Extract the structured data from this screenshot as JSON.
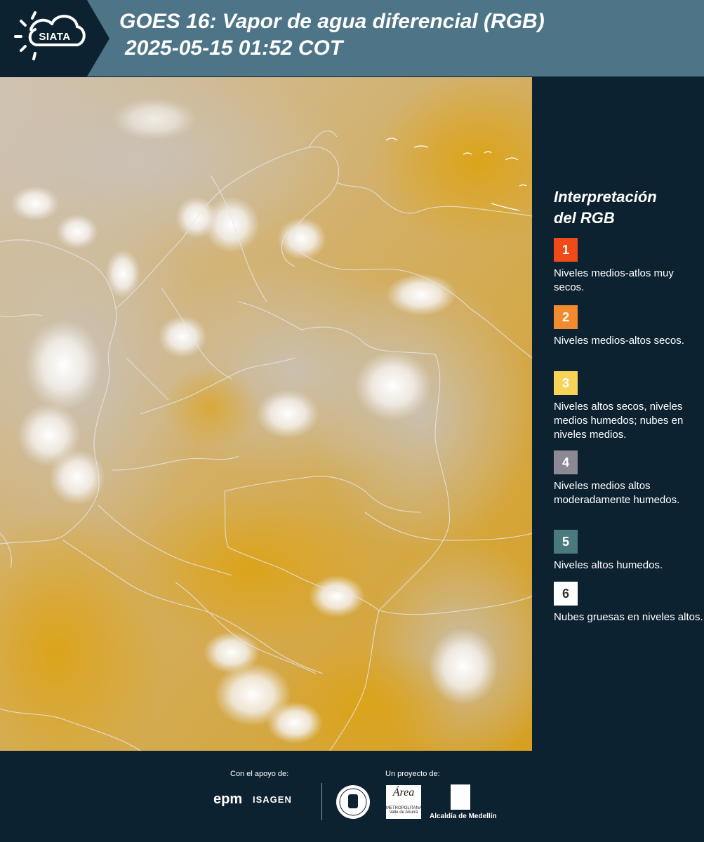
{
  "header": {
    "logo_text": "SIATA",
    "title_line1": "GOES 16: Vapor de agua diferencial (RGB)",
    "title_line2": "2025-05-15 01:52 COT"
  },
  "legend": {
    "title_line1": "Interpretación",
    "title_line2": "del RGB",
    "items": [
      {
        "number": "1",
        "color": "#f04a18",
        "text": "Niveles medios-atlos muy secos."
      },
      {
        "number": "2",
        "color": "#f28a30",
        "text": "Niveles medios-altos secos."
      },
      {
        "number": "3",
        "color": "#f7d35a",
        "text": "Niveles altos secos, niveles medios humedos; nubes en niveles medios."
      },
      {
        "number": "4",
        "color": "#8c8995",
        "text": "Niveles medios altos moderadamente humedos."
      },
      {
        "number": "5",
        "color": "#4a7a7d",
        "text": "Niveles altos humedos."
      },
      {
        "number": "6",
        "color": "#ffffff",
        "text": "Nubes gruesas en niveles altos."
      }
    ]
  },
  "footer": {
    "support_label": "Con el apoyo de:",
    "project_label": "Un proyecto de:",
    "sponsor_epm": "epm",
    "sponsor_isagen": "ISAGEN",
    "partner_area": "Área",
    "partner_area_sub": "METROPOLITANA Valle de Aburrá",
    "partner_alcaldia": "Alcaldía de Medellín"
  },
  "colors": {
    "header_bg": "#4d7587",
    "panel_bg": "#0d2230",
    "map_dry": "#d9a521",
    "map_moist": "#b8ada0",
    "cloud": "#ffffff"
  }
}
